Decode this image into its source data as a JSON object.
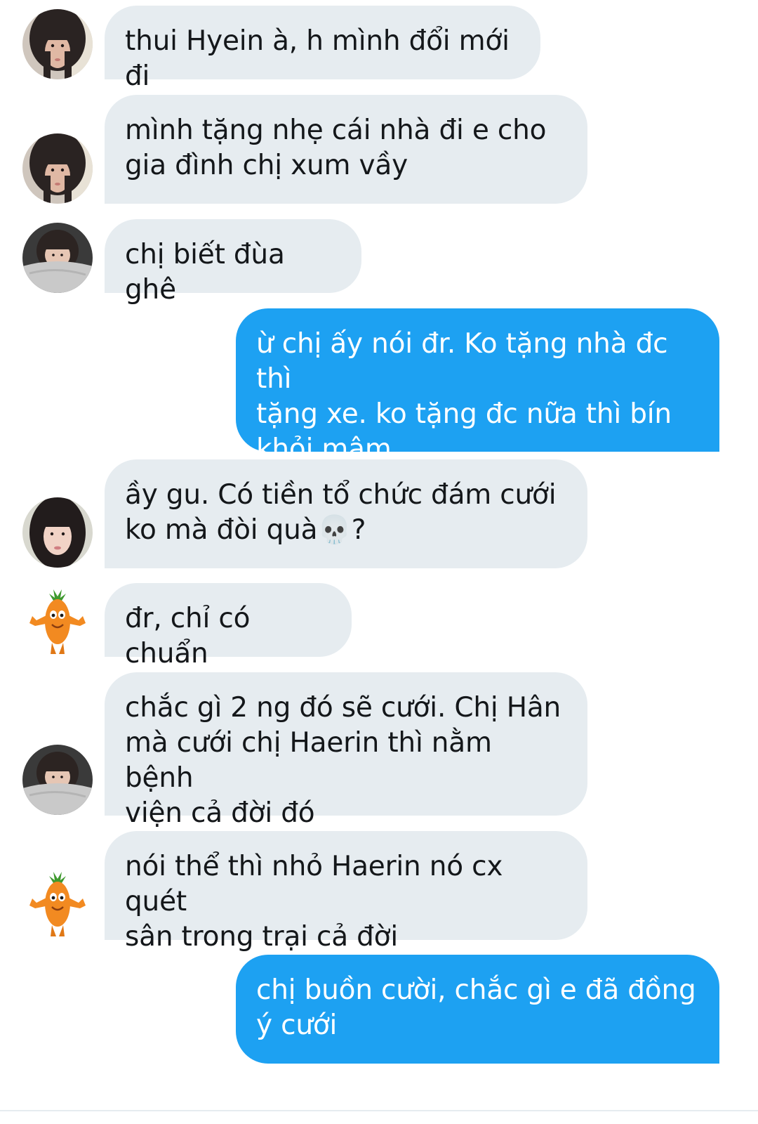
{
  "conversation": {
    "messages": [
      {
        "sender": "incoming",
        "avatar": "girl-hair-avatar",
        "text": "thui Hyein à, h mình đổi mới đi"
      },
      {
        "sender": "incoming",
        "avatar": "girl-hair-avatar",
        "text": "mình tặng nhẹ cái nhà đi e cho\ngia đình chị xum vầy"
      },
      {
        "sender": "incoming",
        "avatar": "girl-blanket-avatar",
        "text": " chị biết đùa ghê"
      },
      {
        "sender": "outgoing",
        "text": "ừ chị ấy nói đr. Ko tặng nhà đc thì\ntặng xe. ko tặng đc nữa thì bín\nkhỏi mâm"
      },
      {
        "sender": "incoming",
        "avatar": "girl-long-hair-avatar",
        "text": "ầy gu. Có tiền tổ chức đám cưới\nko mà đòi quà💀?"
      },
      {
        "sender": "incoming",
        "avatar": "carrot-avatar",
        "text": "đr, chỉ có chuẩn"
      },
      {
        "sender": "incoming",
        "avatar": "girl-blanket-avatar",
        "text": "chắc gì 2 ng đó sẽ cưới. Chị Hân\nmà cưới chị Haerin thì nằm bệnh\nviện cả đời đó"
      },
      {
        "sender": "incoming",
        "avatar": "carrot-avatar",
        "text": "nói thể thì nhỏ Haerin nó cx quét\nsân trong trại cả đời"
      },
      {
        "sender": "outgoing",
        "text": "chị buồn cười, chắc gì e đã đồng\ný cưới"
      }
    ]
  },
  "colors": {
    "incoming_bubble": "#e6ecf0",
    "outgoing_bubble": "#1da1f2",
    "incoming_text": "#14171a",
    "outgoing_text": "#ffffff"
  }
}
